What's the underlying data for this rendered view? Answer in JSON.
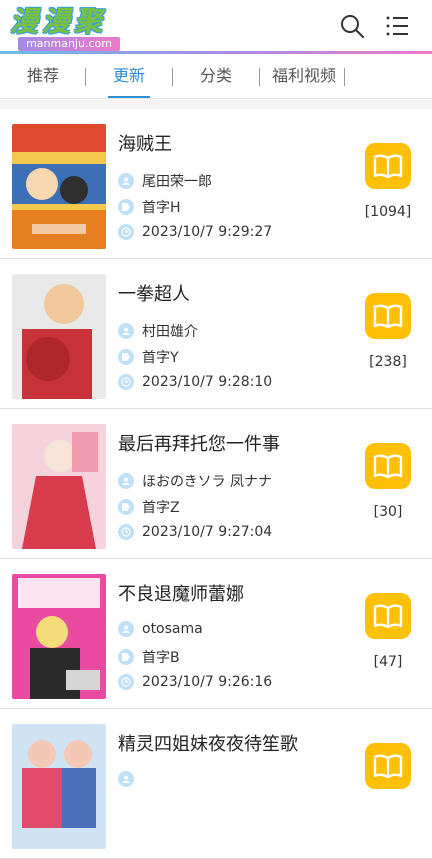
{
  "header": {
    "logo_text": "漫漫聚",
    "logo_sub": "manmanju.com"
  },
  "tabs": [
    {
      "label": "推荐"
    },
    {
      "label": "更新"
    },
    {
      "label": "分类"
    },
    {
      "label": "福利视频"
    }
  ],
  "colors": {
    "accent": "#2a8fd8",
    "read_button": "#ffc107",
    "meta_icon": "#bfe0f5"
  },
  "items": [
    {
      "title": "海贼王",
      "author": "尾田荣一郎",
      "initial": "首字H",
      "time": "2023/10/7 9:29:27",
      "count": "[1094]"
    },
    {
      "title": "一拳超人",
      "author": "村田雄介",
      "initial": "首字Y",
      "time": "2023/10/7 9:28:10",
      "count": "[238]"
    },
    {
      "title": "最后再拜托您一件事",
      "author": "ほおのきソラ 凤ナナ",
      "initial": "首字Z",
      "time": "2023/10/7 9:27:04",
      "count": "[30]"
    },
    {
      "title": "不良退魔师蕾娜",
      "author": "otosama",
      "initial": "首字B",
      "time": "2023/10/7 9:26:16",
      "count": "[47]"
    },
    {
      "title": "精灵四姐妹夜夜待笙歌",
      "author": "",
      "initial": "",
      "time": "",
      "count": ""
    }
  ]
}
